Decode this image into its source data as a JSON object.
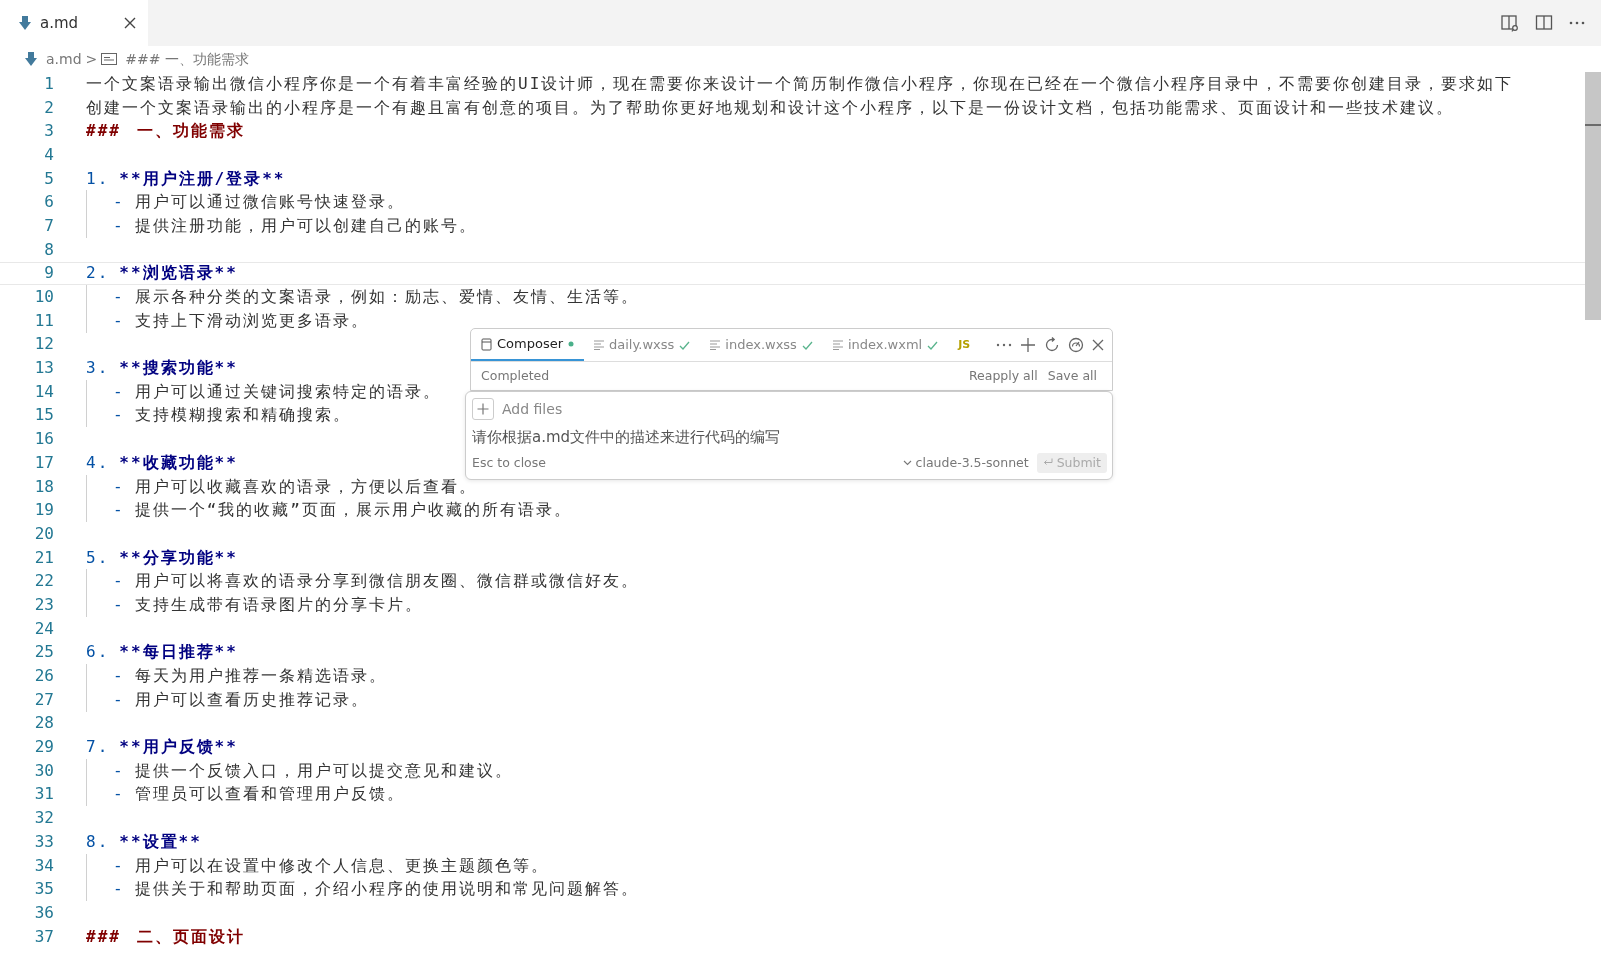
{
  "editor_tabs": [
    {
      "label": "a.md",
      "selected": true
    }
  ],
  "breadcrumb": {
    "file": "a.md",
    "separator": ">",
    "symbol": "### 一、功能需求"
  },
  "lines": [
    {
      "number": "1",
      "kind": "text",
      "text": "一个文案语录输出微信小程序你是一个有着丰富经验的UI设计师，现在需要你来设计一个简历制作微信小程序，你现在已经在一个微信小程序目录中，不需要你创建目录，要求如下",
      "current": false
    },
    {
      "number": "2",
      "kind": "text",
      "text": "创建一个文案语录输出的小程序是一个有趣且富有创意的项目。为了帮助你更好地规划和设计这个小程序，以下是一份设计文档，包括功能需求、页面设计和一些技术建议。",
      "current": false
    },
    {
      "number": "3",
      "kind": "heading",
      "marker": "###",
      "text": "一、功能需求",
      "current": false
    },
    {
      "number": "4",
      "kind": "blank",
      "current": false
    },
    {
      "number": "5",
      "kind": "item",
      "marker": "1.",
      "text": "**用户注册/登录**",
      "current": false
    },
    {
      "number": "6",
      "kind": "bullet",
      "marker": "-",
      "text": "用户可以通过微信账号快速登录。",
      "current": false
    },
    {
      "number": "7",
      "kind": "bullet",
      "marker": "-",
      "text": "提供注册功能，用户可以创建自己的账号。",
      "current": false
    },
    {
      "number": "8",
      "kind": "blank",
      "current": false
    },
    {
      "number": "9",
      "kind": "item",
      "marker": "2.",
      "text": "**浏览语录**",
      "current": true
    },
    {
      "number": "10",
      "kind": "bullet",
      "marker": "-",
      "text": "展示各种分类的文案语录，例如：励志、爱情、友情、生活等。",
      "current": false
    },
    {
      "number": "11",
      "kind": "bullet",
      "marker": "-",
      "text": "支持上下滑动浏览更多语录。",
      "current": false
    },
    {
      "number": "12",
      "kind": "blank",
      "current": false
    },
    {
      "number": "13",
      "kind": "item",
      "marker": "3.",
      "text": "**搜索功能**",
      "current": false
    },
    {
      "number": "14",
      "kind": "bullet",
      "marker": "-",
      "text": "用户可以通过关键词搜索特定的语录。",
      "current": false
    },
    {
      "number": "15",
      "kind": "bullet",
      "marker": "-",
      "text": "支持模糊搜索和精确搜索。",
      "current": false
    },
    {
      "number": "16",
      "kind": "blank",
      "current": false
    },
    {
      "number": "17",
      "kind": "item",
      "marker": "4.",
      "text": "**收藏功能**",
      "current": false
    },
    {
      "number": "18",
      "kind": "bullet",
      "marker": "-",
      "text": "用户可以收藏喜欢的语录，方便以后查看。",
      "current": false
    },
    {
      "number": "19",
      "kind": "bullet",
      "marker": "-",
      "text": "提供一个“我的收藏”页面，展示用户收藏的所有语录。",
      "current": false
    },
    {
      "number": "20",
      "kind": "blank",
      "current": false
    },
    {
      "number": "21",
      "kind": "item",
      "marker": "5.",
      "text": "**分享功能**",
      "current": false
    },
    {
      "number": "22",
      "kind": "bullet",
      "marker": "-",
      "text": "用户可以将喜欢的语录分享到微信朋友圈、微信群或微信好友。",
      "current": false
    },
    {
      "number": "23",
      "kind": "bullet",
      "marker": "-",
      "text": "支持生成带有语录图片的分享卡片。",
      "current": false
    },
    {
      "number": "24",
      "kind": "blank",
      "current": false
    },
    {
      "number": "25",
      "kind": "item",
      "marker": "6.",
      "text": "**每日推荐**",
      "current": false
    },
    {
      "number": "26",
      "kind": "bullet",
      "marker": "-",
      "text": "每天为用户推荐一条精选语录。",
      "current": false
    },
    {
      "number": "27",
      "kind": "bullet",
      "marker": "-",
      "text": "用户可以查看历史推荐记录。",
      "current": false
    },
    {
      "number": "28",
      "kind": "blank",
      "current": false
    },
    {
      "number": "29",
      "kind": "item",
      "marker": "7.",
      "text": "**用户反馈**",
      "current": false
    },
    {
      "number": "30",
      "kind": "bullet",
      "marker": "-",
      "text": "提供一个反馈入口，用户可以提交意见和建议。",
      "current": false
    },
    {
      "number": "31",
      "kind": "bullet",
      "marker": "-",
      "text": "管理员可以查看和管理用户反馈。",
      "current": false
    },
    {
      "number": "32",
      "kind": "blank",
      "current": false
    },
    {
      "number": "33",
      "kind": "item",
      "marker": "8.",
      "text": "**设置**",
      "current": false
    },
    {
      "number": "34",
      "kind": "bullet",
      "marker": "-",
      "text": "用户可以在设置中修改个人信息、更换主题颜色等。",
      "current": false
    },
    {
      "number": "35",
      "kind": "bullet",
      "marker": "-",
      "text": "提供关于和帮助页面，介绍小程序的使用说明和常见问题解答。",
      "current": false
    },
    {
      "number": "36",
      "kind": "blank",
      "current": false
    },
    {
      "number": "37",
      "kind": "heading",
      "marker": "###",
      "text": "二、页面设计",
      "current": false
    }
  ],
  "composer": {
    "tabs": [
      {
        "kind": "composer",
        "label": "Composer",
        "selected": true,
        "checked": false
      },
      {
        "kind": "file",
        "label": "daily.wxss",
        "selected": false,
        "checked": true
      },
      {
        "kind": "file",
        "label": "index.wxss",
        "selected": false,
        "checked": true
      },
      {
        "kind": "file",
        "label": "index.wxml",
        "selected": false,
        "checked": true
      },
      {
        "kind": "script",
        "label": "JS",
        "selected": false,
        "checked": false
      }
    ],
    "status": "Completed",
    "actions": [
      "Reapply all",
      "Save all"
    ],
    "add_files": "Add files",
    "prompt": "请你根据a.md文件中的描述来进行代码的编写",
    "hint": "Esc to close",
    "model": "claude-3.5-sonnet",
    "submit": "Submit"
  }
}
